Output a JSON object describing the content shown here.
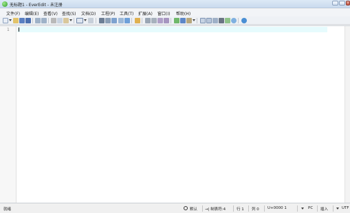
{
  "window": {
    "title": "无标题1 - EverEdit - 未注册"
  },
  "menu": [
    {
      "label": "文件(F)"
    },
    {
      "label": "编辑(E)"
    },
    {
      "label": "查看(V)"
    },
    {
      "label": "查找(S)"
    },
    {
      "label": "文档(D)"
    },
    {
      "label": "工程(P)"
    },
    {
      "label": "工具(T)"
    },
    {
      "label": "扩展(A)"
    },
    {
      "label": "窗口(I)"
    },
    {
      "label": "帮助(H)"
    }
  ],
  "toolbar": {
    "icons": [
      "new-file-icon",
      "open-icon",
      "save-icon",
      "save-all-icon",
      "undo-icon",
      "redo-icon",
      "cut-icon",
      "copy-icon",
      "paste-icon",
      "view-mode-icon",
      "column-icon",
      "find-icon",
      "replace-icon",
      "find-in-files-icon",
      "goto-icon",
      "bookmark-icon",
      "indent-icon",
      "wrap-icon",
      "whitespace-icon",
      "record-macro-icon",
      "play-macro-icon",
      "tool-icon",
      "panel-icon",
      "outline-icon",
      "clip-icon",
      "split-icon",
      "compare-icon",
      "theme-icon",
      "help-icon"
    ]
  },
  "editor": {
    "line_number": "1"
  },
  "status": {
    "ready": "就绪",
    "mode_default": "默认",
    "tab": "→| 制表符:4",
    "row": "行 1",
    "col": "列 0",
    "unicode": "U+0000  1",
    "line_ending": "PC",
    "insert_mode": "插入",
    "encoding": "UTF"
  },
  "colors": {
    "current_line": "#e6fbfd",
    "titlebar": "#c9daee"
  }
}
